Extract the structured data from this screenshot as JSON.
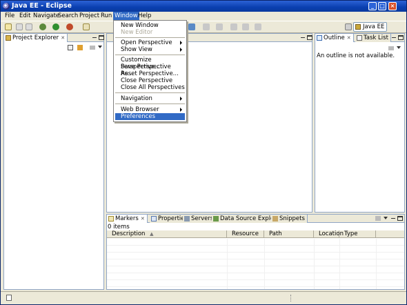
{
  "window": {
    "title": "Java EE - Eclipse"
  },
  "menubar": {
    "items": [
      "File",
      "Edit",
      "Navigate",
      "Search",
      "Project",
      "Run",
      "Window",
      "Help"
    ]
  },
  "window_menu": {
    "items": [
      {
        "label": "New Window",
        "disabled": false,
        "submenu": false
      },
      {
        "label": "New Editor",
        "disabled": true,
        "submenu": false
      },
      {
        "label": "Open Perspective",
        "disabled": false,
        "submenu": true
      },
      {
        "label": "Show View",
        "disabled": false,
        "submenu": true
      },
      {
        "label": "Customize Perspective...",
        "disabled": false,
        "submenu": false
      },
      {
        "label": "Save Perspective As...",
        "disabled": false,
        "submenu": false
      },
      {
        "label": "Reset Perspective...",
        "disabled": false,
        "submenu": false
      },
      {
        "label": "Close Perspective",
        "disabled": false,
        "submenu": false
      },
      {
        "label": "Close All Perspectives",
        "disabled": false,
        "submenu": false
      },
      {
        "label": "Navigation",
        "disabled": false,
        "submenu": true
      },
      {
        "label": "Web Browser",
        "disabled": false,
        "submenu": true
      },
      {
        "label": "Preferences",
        "disabled": false,
        "submenu": false,
        "highlighted": true
      }
    ]
  },
  "toolbar": {
    "perspective_label": "Java EE"
  },
  "project_explorer": {
    "tab_label": "Project Explorer"
  },
  "outline": {
    "tab_label": "Outline",
    "second_tab_label": "Task List",
    "message": "An outline is not available."
  },
  "bottom": {
    "tabs": [
      "Markers",
      "Properties",
      "Servers",
      "Data Source Explorer",
      "Snippets"
    ],
    "count_text": "0 items",
    "columns": [
      "Description",
      "Resource",
      "Path",
      "Location",
      "Type"
    ]
  },
  "colors": {
    "title_bar": "#0a3fb0",
    "selection": "#316ac5",
    "chrome": "#ece9d8"
  }
}
